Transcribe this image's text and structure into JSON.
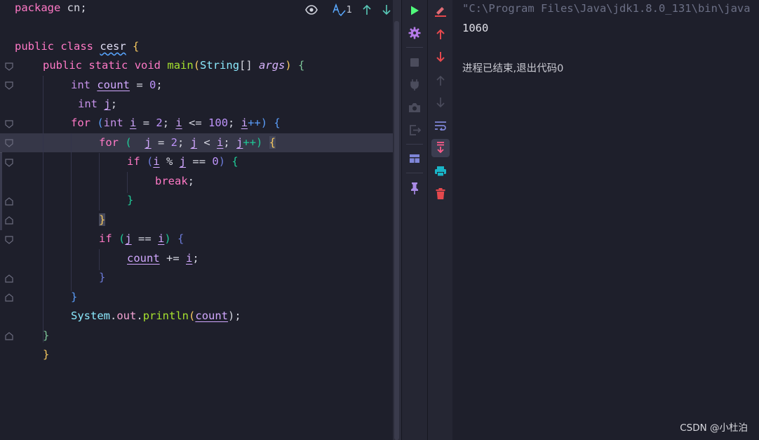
{
  "editor": {
    "toolbar": {
      "problems_count": "1"
    },
    "lines": {
      "l1": [
        "package",
        " cn;"
      ],
      "l2": [
        "public",
        " ",
        "class",
        " ",
        "cesr",
        " ",
        "{"
      ],
      "l3": [
        "public",
        " ",
        "static",
        " ",
        "void",
        " ",
        "main",
        "(",
        "String",
        "[] ",
        "args",
        ") ",
        "{"
      ],
      "l4": [
        "int",
        " ",
        "count",
        " = ",
        "0",
        ";"
      ],
      "l5": [
        "int",
        " ",
        "j",
        ";"
      ],
      "l6": [
        "for",
        " (",
        "int",
        " ",
        "i",
        " = ",
        "2",
        "; ",
        "i",
        " <= ",
        "100",
        "; ",
        "i",
        "++) ",
        "{"
      ],
      "l7": [
        "for",
        " (  ",
        "j",
        " = ",
        "2",
        "; ",
        "j",
        " < ",
        "i",
        "; ",
        "j",
        "++) ",
        "{"
      ],
      "l8": [
        "if",
        " (",
        "i",
        " % ",
        "j",
        " == ",
        "0",
        ") ",
        "{"
      ],
      "l9": [
        "break",
        ";"
      ],
      "l10": [
        "}"
      ],
      "l11": [
        "}"
      ],
      "l12": [
        "if",
        " (",
        "j",
        " == ",
        "i",
        ") ",
        "{"
      ],
      "l13": [
        "count",
        " += ",
        "i",
        ";"
      ],
      "l14": [
        "}"
      ],
      "l15": [
        "}"
      ],
      "l16": [
        "System",
        ".",
        "out",
        ".",
        "println",
        "(",
        "count",
        ");"
      ],
      "l17": [
        "}"
      ],
      "l18": [
        "}"
      ]
    }
  },
  "console": {
    "command": "\"C:\\Program Files\\Java\\jdk1.8.0_131\\bin\\java",
    "output": "1060",
    "exit_message": "进程已结束,退出代码0"
  },
  "watermark": "CSDN @小杜泊",
  "colors": {
    "background": "#1e1f2b",
    "toolbar": "#252633",
    "keyword": "#ff79c6",
    "type": "#c792ea",
    "function": "#a6e22e",
    "stop_red": "#e5484d",
    "run_green": "#50fa7b"
  },
  "icons": {
    "run": "run-icon",
    "settings": "gear-icon",
    "stop": "stop-icon",
    "attach": "plug-icon",
    "dump": "camera-icon",
    "exit": "exit-icon",
    "layout": "layout-icon",
    "pin": "pin-icon",
    "clear": "clear-icon",
    "up": "arrow-up-icon",
    "down": "arrow-down-icon",
    "soft_wrap": "soft-wrap-icon",
    "scroll_end": "scroll-to-end-icon",
    "print": "print-icon",
    "delete": "trash-icon"
  }
}
